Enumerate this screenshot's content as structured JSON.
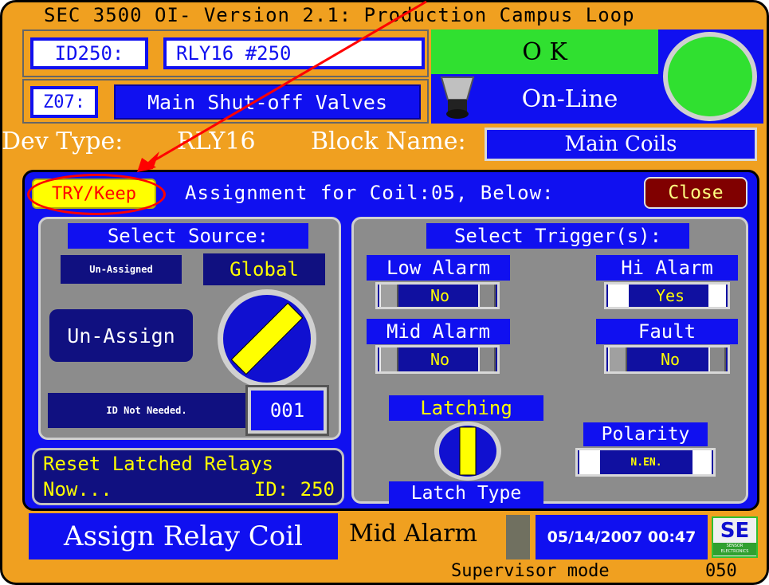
{
  "header": {
    "title": "SEC 3500 OI- Version 2.1: Production Campus Loop"
  },
  "device": {
    "id_label": "ID250:",
    "id_value": "RLY16 #250",
    "zone_label": "Z07:",
    "zone_value": "Main Shut-off Valves",
    "status_ok": "O K",
    "status_online": "On-Line",
    "dev_type_label": "Dev Type:",
    "dev_type_value": "RLY16",
    "block_name_label": "Block Name:",
    "block_name_value": "Main Coils"
  },
  "panel": {
    "try_keep": "TRY/Keep",
    "assignment_text": "Assignment for Coil:05, Below:",
    "close_label": "Close"
  },
  "source": {
    "title": "Select Source:",
    "unassigned_label": "Un-Assigned",
    "global_label": "Global",
    "unassign_button": "Un-Assign",
    "id_not_needed": "ID Not Needed.",
    "id_number": "001"
  },
  "reset": {
    "line1": "Reset Latched Relays",
    "now": "Now...",
    "id": "ID: 250"
  },
  "triggers": {
    "title": "Select Trigger(s):",
    "low_alarm": {
      "label": "Low Alarm",
      "value": "No"
    },
    "hi_alarm": {
      "label": "Hi Alarm",
      "value": "Yes"
    },
    "mid_alarm": {
      "label": "Mid Alarm",
      "value": "No"
    },
    "fault": {
      "label": "Fault",
      "value": "No"
    },
    "latching_label": "Latching",
    "latch_type_label": "Latch Type",
    "polarity_label": "Polarity",
    "polarity_value": "N.EN."
  },
  "footer": {
    "screen_title": "Assign Relay Coil",
    "alarm_text": "Mid Alarm",
    "datetime": "05/14/2007 00:47",
    "logo_text": "SE",
    "logo_sub": "SENSOR ELECTRONICS",
    "mode": "Supervisor mode",
    "code": "050"
  },
  "colors": {
    "frame": "#f0a020",
    "blue": "#1010f0",
    "ok_green": "#30e030",
    "text_yellow": "#ffff00",
    "annotation_red": "#ff0000"
  }
}
